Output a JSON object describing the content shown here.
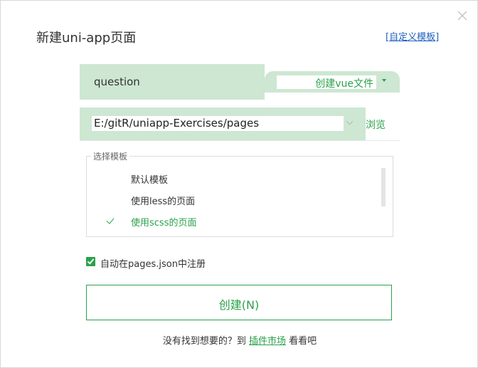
{
  "dialog": {
    "title": "新建uni-app页面",
    "custom_template_link": "自定义模板",
    "custom_template_open": "[",
    "custom_template_close": "]"
  },
  "name_field": {
    "value": "question"
  },
  "file_type": {
    "selected": "创建vue文件"
  },
  "path_field": {
    "value": "E:/gitR/uniapp-Exercises/pages",
    "browse_label": "浏览"
  },
  "template_group": {
    "legend": "选择模板",
    "items": [
      {
        "label": "默认模板",
        "selected": false
      },
      {
        "label": "使用less的页面",
        "selected": false
      },
      {
        "label": "使用scss的页面",
        "selected": true
      }
    ]
  },
  "register": {
    "label": "自动在pages.json中注册",
    "checked": true
  },
  "create_button": {
    "label": "创建(N)"
  },
  "footer": {
    "prefix": "没有找到想要的？到",
    "market_link": "插件市场",
    "suffix": "看看吧"
  },
  "colors": {
    "accent": "#2aa14a",
    "input_bg": "#cde7d2",
    "link": "#1f5fbf"
  },
  "icons": {
    "close": "close-icon",
    "check": "check-icon",
    "dropdown": "chevron-down-icon"
  }
}
